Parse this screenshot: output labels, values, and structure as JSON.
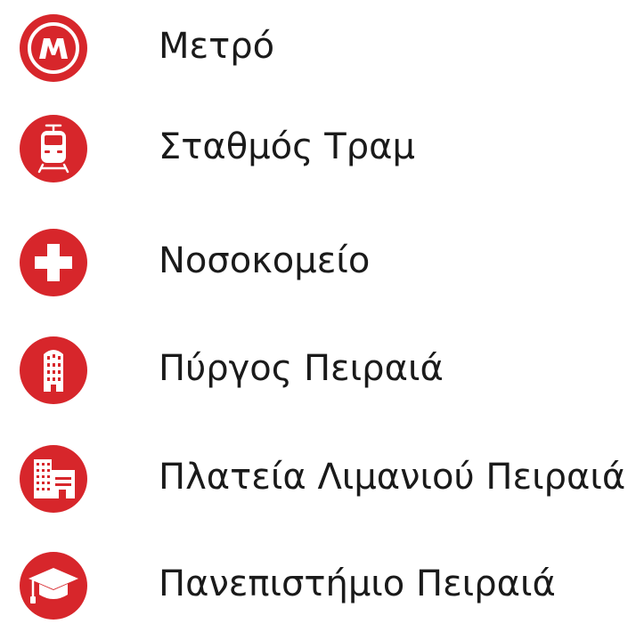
{
  "legend": {
    "items": [
      {
        "icon": "metro-icon",
        "label": "Μετρό"
      },
      {
        "icon": "tram-icon",
        "label": "Σταθμός Τραμ"
      },
      {
        "icon": "hospital-cross-icon",
        "label": "Νοσοκομείο"
      },
      {
        "icon": "tower-building-icon",
        "label": "Πύργος Πειραιά"
      },
      {
        "icon": "square-buildings-icon",
        "label": "Πλατεία Λιμανιού Πειραιά"
      },
      {
        "icon": "graduation-cap-icon",
        "label": "Πανεπιστήμιο Πειραιά"
      }
    ]
  },
  "colors": {
    "icon_background": "#d7262b",
    "icon_glyph": "#ffffff",
    "text": "#1a1a1a"
  }
}
